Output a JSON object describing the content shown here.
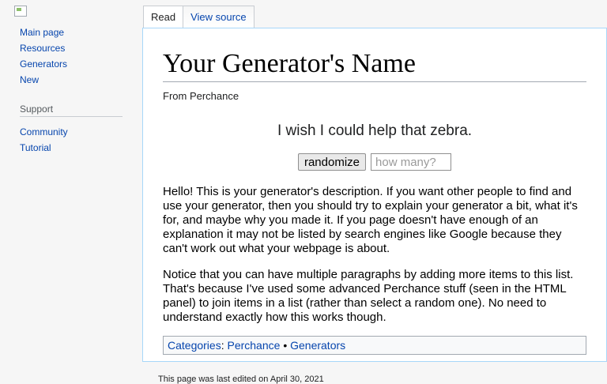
{
  "sidebar": {
    "nav_items": [
      "Main page",
      "Resources",
      "Generators",
      "New"
    ],
    "support_heading": "Support",
    "support_items": [
      "Community",
      "Tutorial"
    ]
  },
  "tabs": {
    "read": "Read",
    "view_source": "View source"
  },
  "page": {
    "title": "Your Generator's Name",
    "from": "From Perchance",
    "output": "I wish I could help that zebra.",
    "randomize_label": "randomize",
    "count_placeholder": "how many?",
    "description": [
      "Hello! This is your generator's description. If you want other people to find and use your generator, then you should try to explain your generator a bit, what it's for, and maybe why you made it. If you page doesn't have enough of an explanation it may not be listed by search engines like Google because they can't work out what your webpage is about.",
      "Notice that you can have multiple paragraphs by adding more items to this list. That's because I've used some advanced Perchance stuff (seen in the HTML panel) to join items in a list (rather than select a random one). No need to understand exactly how this works though."
    ],
    "categories_label": "Categories",
    "categories": [
      "Perchance",
      "Generators"
    ],
    "category_separator": "•"
  },
  "footer": {
    "last_edited": "This page was last edited on April 30, 2021"
  }
}
